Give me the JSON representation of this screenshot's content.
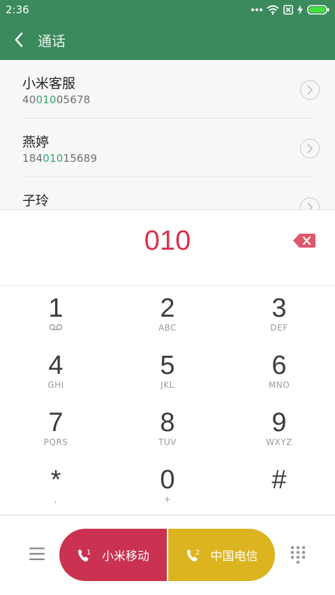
{
  "status": {
    "time": "2:36"
  },
  "appbar": {
    "title": "通话"
  },
  "contacts": [
    {
      "name": "小米客服",
      "number_pre": "40",
      "number_match": "010",
      "number_post": "05678"
    },
    {
      "name": "燕婷",
      "number_pre": "184",
      "number_match": "010",
      "number_post": "15689"
    },
    {
      "name": "子玲",
      "number_pre": "",
      "number_match": "",
      "number_post": ""
    }
  ],
  "dialer": {
    "input": "010",
    "keys": [
      {
        "digit": "1",
        "letters": ""
      },
      {
        "digit": "2",
        "letters": "ABC"
      },
      {
        "digit": "3",
        "letters": "DEF"
      },
      {
        "digit": "4",
        "letters": "GHI"
      },
      {
        "digit": "5",
        "letters": "JKL"
      },
      {
        "digit": "6",
        "letters": "MNO"
      },
      {
        "digit": "7",
        "letters": "PQRS"
      },
      {
        "digit": "8",
        "letters": "TUV"
      },
      {
        "digit": "9",
        "letters": "WXYZ"
      },
      {
        "digit": "*",
        "letters": ","
      },
      {
        "digit": "0",
        "letters": "+"
      },
      {
        "digit": "#",
        "letters": ""
      }
    ]
  },
  "call": {
    "sim1": {
      "label": "小米移动",
      "slot": "1",
      "color": "#cb3150"
    },
    "sim2": {
      "label": "中国电信",
      "slot": "2",
      "color": "#dcb41f"
    }
  },
  "colors": {
    "appbar": "#3a8a5d",
    "match": "#33a86a",
    "dialed": "#d7334b"
  }
}
